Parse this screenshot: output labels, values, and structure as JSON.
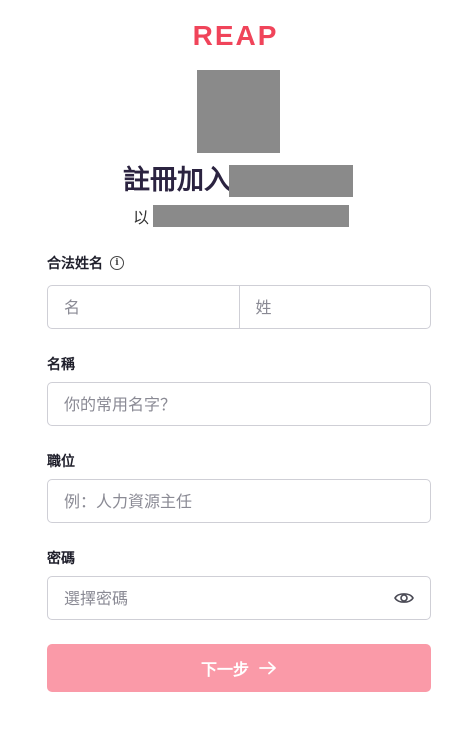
{
  "brand": {
    "logo": "REAP"
  },
  "header": {
    "title": "註冊加入",
    "subtitle_prefix": "以"
  },
  "form": {
    "legal_name": {
      "label": "合法姓名",
      "first_placeholder": "名",
      "last_placeholder": "姓"
    },
    "display_name": {
      "label": "名稱",
      "placeholder": "你的常用名字？"
    },
    "job_title": {
      "label": "職位",
      "placeholder": "例：人力資源主任"
    },
    "password": {
      "label": "密碼",
      "placeholder": "選擇密碼"
    }
  },
  "actions": {
    "next_label": "下一步"
  },
  "colors": {
    "brand": "#f0445a",
    "button": "#fa9aa8",
    "heading": "#2b2340"
  },
  "icons": [
    "info-icon",
    "eye-icon",
    "arrow-right-icon"
  ]
}
